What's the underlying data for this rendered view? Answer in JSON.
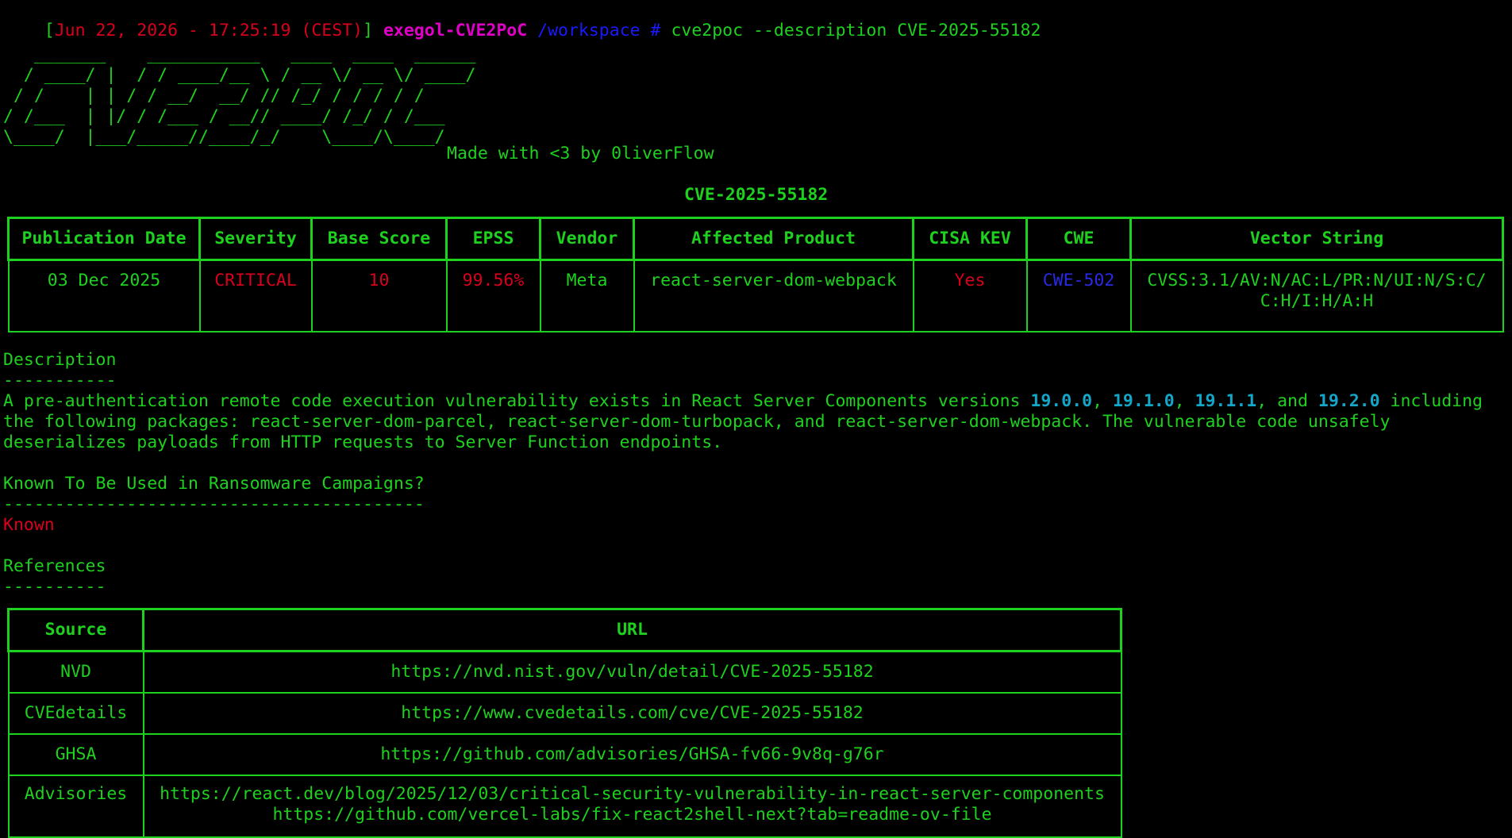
{
  "prompt": {
    "bracket_open": "[",
    "timestamp": "Jun 22, 2026 - 17:25:19 (CEST)",
    "bracket_close": "]",
    "host": "exegol-CVE2PoC",
    "path": "/workspace",
    "symbol": "#",
    "command": "cve2poc",
    "args": "--description CVE-2025-55182"
  },
  "banner": {
    "art": "   _______    ___________   ____  ____  ______\n  / ____/ |  / / ____/__ \\ / __ \\/ __ \\/ ____/\n / /    | | / / __/  __/ // /_/ / / / / /     \n/ /___  | |/ / /___ / __// ____/ /_/ / /___   \n\\____/  |___/_____//____/_/    \\____/\\____/   ",
    "tagline": "Made with <3 by 0liverFlow"
  },
  "cve_id": "CVE-2025-55182",
  "main_table": {
    "headers": [
      "Publication Date",
      "Severity",
      "Base Score",
      "EPSS",
      "Vendor",
      "Affected Product",
      "CISA KEV",
      "CWE",
      "Vector String"
    ],
    "row": {
      "publication_date": "03 Dec 2025",
      "severity": "CRITICAL",
      "base_score": "10",
      "epss": "99.56%",
      "vendor": "Meta",
      "affected_product": "react-server-dom-webpack",
      "cisa_kev": "Yes",
      "cwe": "CWE-502",
      "vector_line1": "CVSS:3.1/AV:N/AC:L/PR:N/UI:N/S:C/",
      "vector_line2": "C:H/I:H/A:H"
    }
  },
  "description": {
    "title": "Description",
    "underline": "-----------",
    "line1_a": "A pre-authentication remote code execution vulnerability exists in React Server Components versions ",
    "v1": "19.0.0",
    "sep1": ", ",
    "v2": "19.1.0",
    "sep2": ", ",
    "v3": "19.1.1",
    "sep3": ", and ",
    "v4": "19.2.0",
    "line1_b": " including",
    "line2": "the following packages: react-server-dom-parcel, react-server-dom-turbopack, and react-server-dom-webpack. The vulnerable code unsafely",
    "line3": "deserializes payloads from HTTP requests to Server Function endpoints."
  },
  "ransomware": {
    "title": "Known To Be Used in Ransomware Campaigns?",
    "underline": "-----------------------------------------",
    "value": "Known"
  },
  "references": {
    "title": "References",
    "underline": "----------",
    "headers": [
      "Source",
      "URL"
    ],
    "rows": [
      {
        "source": "NVD",
        "url": "https://nvd.nist.gov/vuln/detail/CVE-2025-55182"
      },
      {
        "source": "CVEdetails",
        "url": "https://www.cvedetails.com/cve/CVE-2025-55182"
      },
      {
        "source": "GHSA",
        "url": "https://github.com/advisories/GHSA-fv66-9v8q-g76r"
      },
      {
        "source": "Advisories",
        "url": "https://react.dev/blog/2025/12/03/critical-security-vulnerability-in-react-server-components",
        "url2": "https://github.com/vercel-labs/fix-react2shell-next?tab=readme-ov-file"
      }
    ]
  },
  "colors": {
    "background": "#000000",
    "text_green": "#1fd11f",
    "critical_red": "#d8001c",
    "host_magenta": "#e000c8",
    "path_blue": "#1a1aff",
    "version_cyan": "#13a6c8"
  }
}
